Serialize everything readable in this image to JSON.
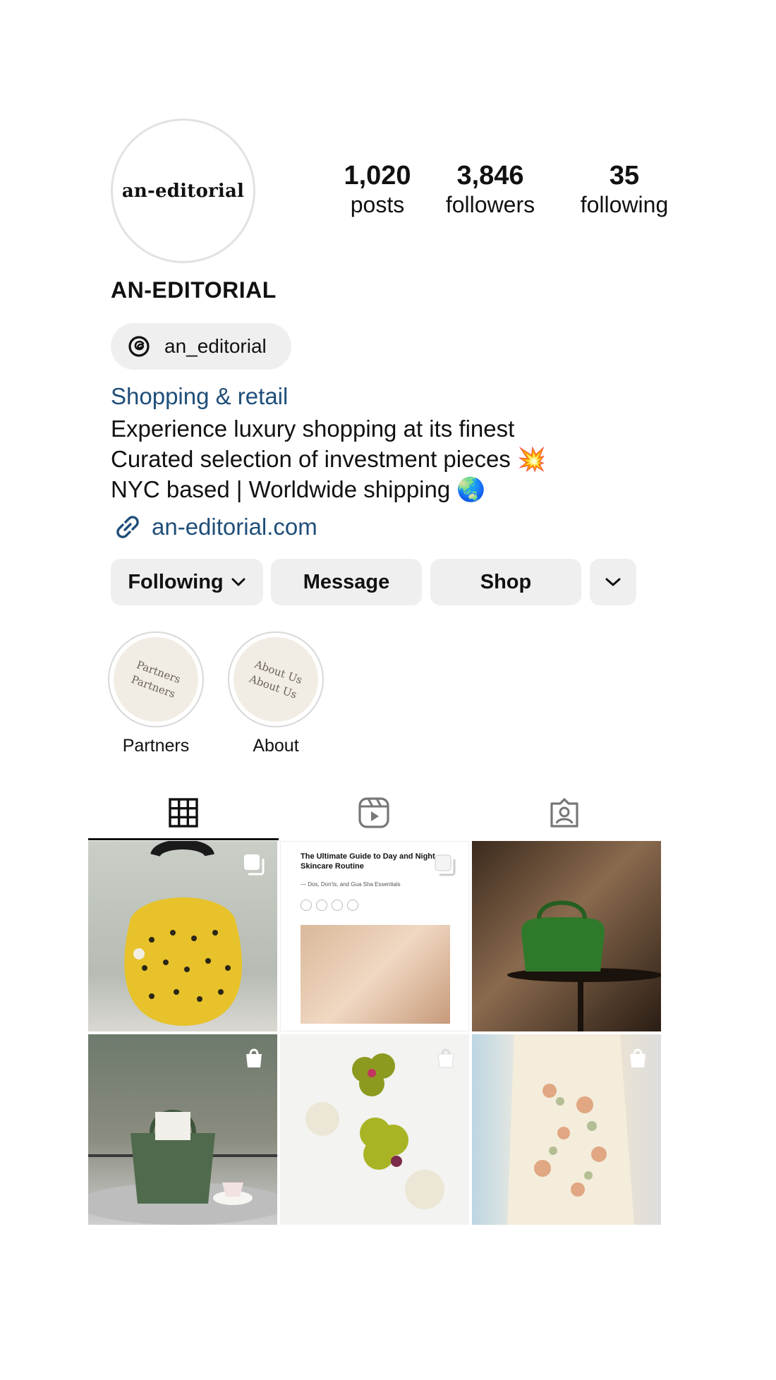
{
  "profile": {
    "avatar_text": "an-editorial",
    "username": "AN-EDITORIAL",
    "threads_handle": "an_editorial",
    "category": "Shopping & retail",
    "bio_lines": [
      "Experience luxury shopping at its finest",
      "Curated selection of investment pieces 💥",
      "NYC based | Worldwide shipping 🌏"
    ],
    "link": "an-editorial.com",
    "accent_color": "#1f4e79"
  },
  "stats": {
    "posts": {
      "value": "1,020",
      "label": "posts"
    },
    "followers": {
      "value": "3,846",
      "label": "followers"
    },
    "following": {
      "value": "35",
      "label": "following"
    }
  },
  "buttons": {
    "following": "Following",
    "message": "Message",
    "shop": "Shop"
  },
  "highlights": [
    {
      "label": "Partners",
      "cover_text": "Partners"
    },
    {
      "label": "About",
      "cover_text": "About Us"
    }
  ],
  "tabs": [
    {
      "icon": "grid-icon",
      "active": true
    },
    {
      "icon": "reels-icon",
      "active": false
    },
    {
      "icon": "tagged-icon",
      "active": false
    }
  ],
  "grid": {
    "post2_title": "The Ultimate Guide to Day and Night Skincare Routine",
    "post2_subtitle": "— Dos, Don'ts, and Gua Sha Essentials",
    "posts": [
      {
        "content": "yellow polka-dot handbag",
        "badge": "carousel-icon"
      },
      {
        "content": "skincare guide article",
        "badge": "carousel-icon"
      },
      {
        "content": "green handbag on table",
        "badge": ""
      },
      {
        "content": "green woven handbag with tea",
        "badge": "shopping-bag-icon"
      },
      {
        "content": "floral pearl earrings",
        "badge": "shopping-bag-icon"
      },
      {
        "content": "floral printed blouse",
        "badge": "shopping-bag-icon"
      }
    ]
  }
}
